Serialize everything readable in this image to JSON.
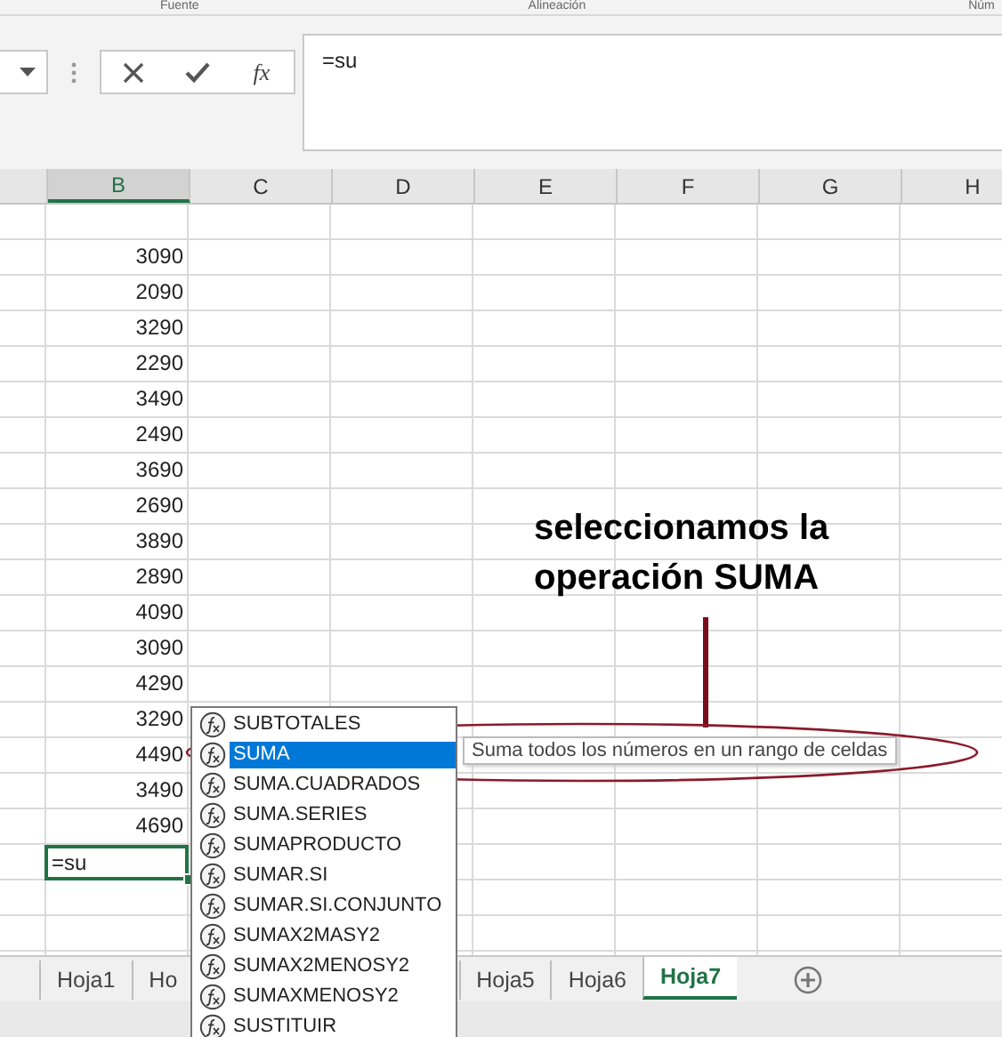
{
  "ribbon_groups": [
    "Fuente",
    "Alineación",
    "Núm"
  ],
  "formula_bar": {
    "function_label": "fx",
    "value": "=su"
  },
  "columns": [
    {
      "label": "B",
      "selected": true
    },
    {
      "label": "C",
      "selected": false
    },
    {
      "label": "D",
      "selected": false
    },
    {
      "label": "E",
      "selected": false
    },
    {
      "label": "F",
      "selected": false
    },
    {
      "label": "G",
      "selected": false
    },
    {
      "label": "H",
      "selected": false
    }
  ],
  "column_b_values": [
    "3090",
    "2090",
    "3290",
    "2290",
    "3490",
    "2490",
    "3690",
    "2690",
    "3890",
    "2890",
    "4090",
    "3090",
    "4290",
    "3290",
    "4490",
    "3490",
    "4690"
  ],
  "active_cell": {
    "value": "=su"
  },
  "annotation": {
    "text": "seleccionamos la operación SUMA"
  },
  "autocomplete": {
    "items": [
      {
        "label": "SUBTOTALES",
        "selected": false
      },
      {
        "label": "SUMA",
        "selected": true
      },
      {
        "label": "SUMA.CUADRADOS",
        "selected": false
      },
      {
        "label": "SUMA.SERIES",
        "selected": false
      },
      {
        "label": "SUMAPRODUCTO",
        "selected": false
      },
      {
        "label": "SUMAR.SI",
        "selected": false
      },
      {
        "label": "SUMAR.SI.CONJUNTO",
        "selected": false
      },
      {
        "label": "SUMAX2MASY2",
        "selected": false
      },
      {
        "label": "SUMAX2MENOSY2",
        "selected": false
      },
      {
        "label": "SUMAXMENOSY2",
        "selected": false
      },
      {
        "label": "SUSTITUIR",
        "selected": false
      }
    ],
    "tooltip": "Suma todos los números en un rango de celdas"
  },
  "sheet_tabs": [
    {
      "label": "Hoja1",
      "selected": false
    },
    {
      "label": "Ho",
      "selected": false
    },
    {
      "label": "Hoja5",
      "selected": false
    },
    {
      "label": "Hoja6",
      "selected": false
    },
    {
      "label": "Hoja7",
      "selected": true
    }
  ]
}
